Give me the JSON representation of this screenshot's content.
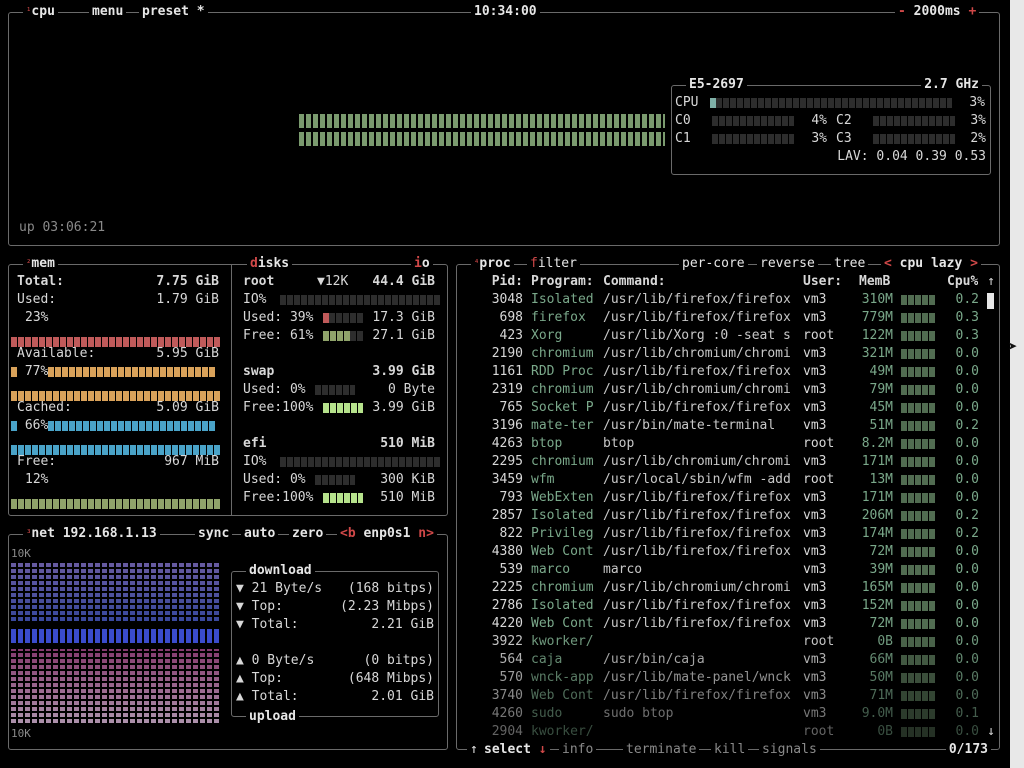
{
  "cpu_box": {
    "title_num": "¹",
    "title": "cpu",
    "menu": "menu",
    "preset": "preset *",
    "clock": "10:34:00",
    "minus": "-",
    "interval": "2000ms",
    "plus": "+",
    "uptime": "up 03:06:21",
    "model": "E5-2697",
    "freq": "2.7 GHz",
    "cpu_label": "CPU",
    "cpu_pct": "3%",
    "cores": [
      {
        "label": "C0",
        "pct": "4%"
      },
      {
        "label": "C1",
        "pct": "3%"
      },
      {
        "label": "C2",
        "pct": "3%"
      },
      {
        "label": "C3",
        "pct": "2%"
      }
    ],
    "lav_label": "LAV:",
    "lav": "0.04 0.39 0.53",
    "graph_color": "#7a9a6e"
  },
  "mem_box": {
    "title_num": "²",
    "title": "mem",
    "total_label": "Total:",
    "total": "7.75 GiB",
    "used_label": "Used:",
    "used": "1.79 GiB",
    "used_pct": "23%",
    "available_label": "Available:",
    "available": "5.95 GiB",
    "available_pct": "77%",
    "cached_label": "Cached:",
    "cached": "5.09 GiB",
    "cached_pct": "66%",
    "free_label": "Free:",
    "free": "967 MiB",
    "free_pct": "12%",
    "colors": {
      "used": "#c05a5a",
      "available": "#d9a25a",
      "cached": "#4aa3c8",
      "free": "#8fa36a"
    }
  },
  "disks_box": {
    "title": "disks",
    "io": "io",
    "root": {
      "name": "root",
      "io_speed": "▼12K",
      "size": "44.4 GiB",
      "io_label": "IO%",
      "used_label": "Used: 39%",
      "used": "17.3 GiB",
      "free_label": "Free: 61%",
      "free": "27.1 GiB"
    },
    "swap": {
      "name": "swap",
      "size": "3.99 GiB",
      "used_label": "Used:  0%",
      "used": "0 Byte",
      "free_label": "Free:100%",
      "free": "3.99 GiB"
    },
    "efi": {
      "name": "efi",
      "size": "510 MiB",
      "io_label": "IO%",
      "used_label": "Used:  0%",
      "used": "300 KiB",
      "free_label": "Free:100%",
      "free": "510 MiB"
    }
  },
  "net_box": {
    "title_num": "³",
    "title": "net",
    "ip": "192.168.1.13",
    "sync": "sync",
    "auto": "auto",
    "zero": "zero",
    "iface_prev": "<b",
    "iface": "enp0s1",
    "iface_next": "n>",
    "scale_top": "10K",
    "scale_bottom": "10K",
    "download_label": "download",
    "upload_label": "upload",
    "down_rate": "21 Byte/s",
    "down_bits": "(168 bitps)",
    "down_top_label": "Top:",
    "down_top": "(2.23 Mibps)",
    "down_total_label": "Total:",
    "down_total": "2.21 GiB",
    "up_rate": "0 Byte/s",
    "up_bits": "(0 bitps)",
    "up_top_label": "Top:",
    "up_top": "(648 Mibps)",
    "up_total_label": "Total:",
    "up_total": "2.01 GiB"
  },
  "proc_box": {
    "title_num": "⁴",
    "title": "proc",
    "filter": "filter",
    "per_core": "per-core",
    "reverse": "reverse",
    "tree": "tree",
    "sort_prev": "<",
    "sort": "cpu lazy",
    "sort_next": ">",
    "headers": {
      "pid": "Pid:",
      "program": "Program:",
      "command": "Command:",
      "user": "User:",
      "mem": "MemB",
      "cpu": "Cpu%"
    },
    "rows": [
      {
        "pid": "3048",
        "program": "Isolated",
        "command": "/usr/lib/firefox/firefox",
        "user": "vm3",
        "mem": "310M",
        "cpu": "0.2"
      },
      {
        "pid": "698",
        "program": "firefox",
        "command": "/usr/lib/firefox/firefox",
        "user": "vm3",
        "mem": "779M",
        "cpu": "0.3"
      },
      {
        "pid": "423",
        "program": "Xorg",
        "command": "/usr/lib/Xorg :0 -seat s",
        "user": "root",
        "mem": "122M",
        "cpu": "0.3"
      },
      {
        "pid": "2190",
        "program": "chromium",
        "command": "/usr/lib/chromium/chromi",
        "user": "vm3",
        "mem": "321M",
        "cpu": "0.0"
      },
      {
        "pid": "1161",
        "program": "RDD Proc",
        "command": "/usr/lib/firefox/firefox",
        "user": "vm3",
        "mem": "49M",
        "cpu": "0.0"
      },
      {
        "pid": "2319",
        "program": "chromium",
        "command": "/usr/lib/chromium/chromi",
        "user": "vm3",
        "mem": "79M",
        "cpu": "0.0"
      },
      {
        "pid": "765",
        "program": "Socket P",
        "command": "/usr/lib/firefox/firefox",
        "user": "vm3",
        "mem": "45M",
        "cpu": "0.0"
      },
      {
        "pid": "3196",
        "program": "mate-ter",
        "command": "/usr/bin/mate-terminal",
        "user": "vm3",
        "mem": "51M",
        "cpu": "0.2"
      },
      {
        "pid": "4263",
        "program": "btop",
        "command": "btop",
        "user": "root",
        "mem": "8.2M",
        "cpu": "0.0"
      },
      {
        "pid": "2295",
        "program": "chromium",
        "command": "/usr/lib/chromium/chromi",
        "user": "vm3",
        "mem": "171M",
        "cpu": "0.0"
      },
      {
        "pid": "3459",
        "program": "wfm",
        "command": "/usr/local/sbin/wfm -add",
        "user": "root",
        "mem": "13M",
        "cpu": "0.0"
      },
      {
        "pid": "793",
        "program": "WebExten",
        "command": "/usr/lib/firefox/firefox",
        "user": "vm3",
        "mem": "171M",
        "cpu": "0.0"
      },
      {
        "pid": "2857",
        "program": "Isolated",
        "command": "/usr/lib/firefox/firefox",
        "user": "vm3",
        "mem": "206M",
        "cpu": "0.2"
      },
      {
        "pid": "822",
        "program": "Privileg",
        "command": "/usr/lib/firefox/firefox",
        "user": "vm3",
        "mem": "174M",
        "cpu": "0.2"
      },
      {
        "pid": "4380",
        "program": "Web Cont",
        "command": "/usr/lib/firefox/firefox",
        "user": "vm3",
        "mem": "72M",
        "cpu": "0.0"
      },
      {
        "pid": "539",
        "program": "marco",
        "command": "marco",
        "user": "vm3",
        "mem": "39M",
        "cpu": "0.0"
      },
      {
        "pid": "2225",
        "program": "chromium",
        "command": "/usr/lib/chromium/chromi",
        "user": "vm3",
        "mem": "165M",
        "cpu": "0.0"
      },
      {
        "pid": "2786",
        "program": "Isolated",
        "command": "/usr/lib/firefox/firefox",
        "user": "vm3",
        "mem": "152M",
        "cpu": "0.0"
      },
      {
        "pid": "4220",
        "program": "Web Cont",
        "command": "/usr/lib/firefox/firefox",
        "user": "vm3",
        "mem": "72M",
        "cpu": "0.0"
      },
      {
        "pid": "3922",
        "program": "kworker/",
        "command": "",
        "user": "root",
        "mem": "0B",
        "cpu": "0.0"
      },
      {
        "pid": "564",
        "program": "caja",
        "command": "/usr/bin/caja",
        "user": "vm3",
        "mem": "66M",
        "cpu": "0.0"
      },
      {
        "pid": "570",
        "program": "wnck-app",
        "command": "/usr/lib/mate-panel/wnck",
        "user": "vm3",
        "mem": "50M",
        "cpu": "0.0"
      },
      {
        "pid": "3740",
        "program": "Web Cont",
        "command": "/usr/lib/firefox/firefox",
        "user": "vm3",
        "mem": "71M",
        "cpu": "0.0"
      },
      {
        "pid": "4260",
        "program": "sudo",
        "command": "sudo btop",
        "user": "vm3",
        "mem": "9.0M",
        "cpu": "0.1"
      },
      {
        "pid": "2904",
        "program": "kworker/",
        "command": "",
        "user": "root",
        "mem": "0B",
        "cpu": "0.0"
      }
    ],
    "footer": {
      "up": "↑",
      "select": "select",
      "down": "↓",
      "info": "info",
      "terminate": "terminate",
      "kill": "kill",
      "signals": "signals",
      "count": "0/173"
    },
    "scroll_up": "↑",
    "scroll_down": "↓"
  }
}
